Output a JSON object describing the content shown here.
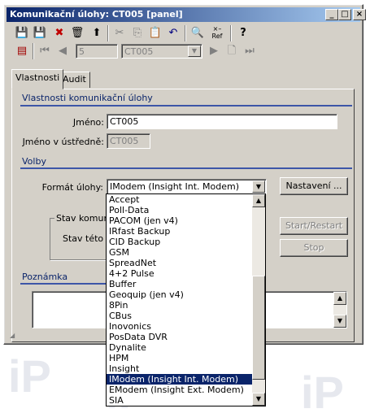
{
  "window": {
    "title": "Komunikační úlohy: CT005 [panel]"
  },
  "titlebar_buttons": {
    "minimize": "_",
    "maximize": "□",
    "close": "×"
  },
  "toolbar": {
    "record_number": "5",
    "record_combo": "CT005",
    "ref_label": "Ref"
  },
  "tabs": [
    {
      "label": "Vlastnosti"
    },
    {
      "label": "Audit"
    }
  ],
  "sections": {
    "properties": "Vlastnosti komunikační úlohy",
    "options": "Volby",
    "note": "Poznámka"
  },
  "fields": {
    "name_label": "Jméno:",
    "name_value": "CT005",
    "panel_name_label": "Jméno v ústředně:",
    "panel_name_value": "CT005",
    "format_label": "Formát úlohy:",
    "format_value": "IModem (Insight Int. Modem)"
  },
  "buttons": {
    "settings": "Nastavení ...",
    "start_restart": "Start/Restart",
    "stop": "Stop"
  },
  "status_group": {
    "title": "Stav komuni",
    "text": "Stav této k"
  },
  "dropdown": {
    "options": [
      "Accept",
      "Poll-Data",
      "PACOM (jen v4)",
      "IRfast Backup",
      "CID Backup",
      "GSM",
      "SpreadNet",
      "4+2 Pulse",
      "Buffer",
      "Geoquip (jen v4)",
      "8Pin",
      "CBus",
      "Inovonics",
      "PosData DVR",
      "Dynalite",
      "HPM",
      "Insight",
      "IModem (Insight Int. Modem)",
      "EModem (Insight Ext. Modem)",
      "SIA"
    ],
    "selected_index": 17
  },
  "background_logo": "iP"
}
